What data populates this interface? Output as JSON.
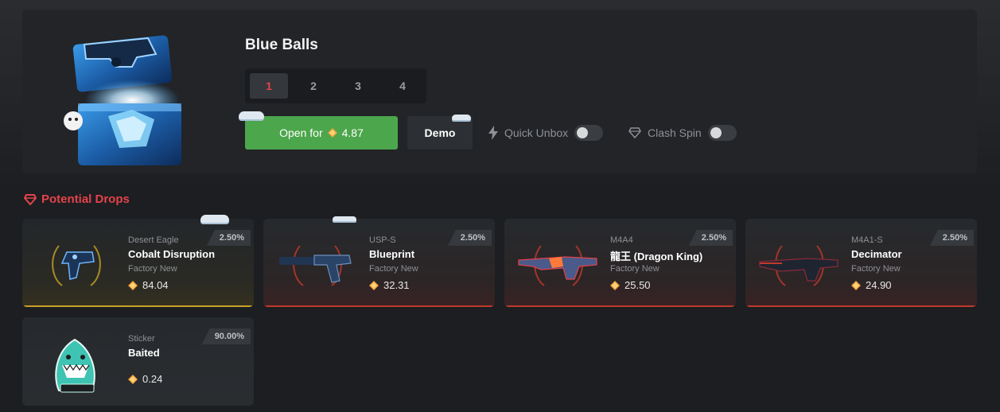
{
  "case": {
    "title": "Blue Balls",
    "count_tabs": [
      "1",
      "2",
      "3",
      "4"
    ],
    "active_tab": "1",
    "open_label": "Open for",
    "open_price": "4.87",
    "demo_label": "Demo",
    "quick_unbox_label": "Quick Unbox",
    "clash_spin_label": "Clash Spin"
  },
  "drops": {
    "heading": "Potential Drops",
    "items": [
      {
        "weapon": "Desert Eagle",
        "skin": "Cobalt Disruption",
        "wear": "Factory New",
        "price": "84.04",
        "chance": "2.50%",
        "rarity": "gold"
      },
      {
        "weapon": "USP-S",
        "skin": "Blueprint",
        "wear": "Factory New",
        "price": "32.31",
        "chance": "2.50%",
        "rarity": "red"
      },
      {
        "weapon": "M4A4",
        "skin": "龍王 (Dragon King)",
        "wear": "Factory New",
        "price": "25.50",
        "chance": "2.50%",
        "rarity": "red"
      },
      {
        "weapon": "M4A1-S",
        "skin": "Decimator",
        "wear": "Factory New",
        "price": "24.90",
        "chance": "2.50%",
        "rarity": "red"
      },
      {
        "weapon": "Sticker",
        "skin": "Baited",
        "wear": "",
        "price": "0.24",
        "chance": "90.00%",
        "rarity": "plain"
      }
    ]
  },
  "colors": {
    "accent_red": "#e3434b",
    "open_green": "#4ca64c",
    "coin_orange": "#f0a13a",
    "rarity_gold": "#c9a227",
    "rarity_red": "#c0392b"
  },
  "icons": {
    "bolt": "lightning-icon",
    "diamond": "diamond-icon",
    "coin": "coin-icon"
  }
}
